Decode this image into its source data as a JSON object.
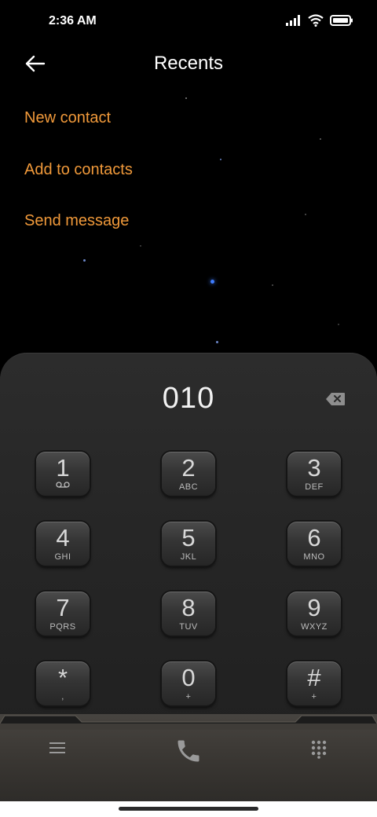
{
  "status_bar": {
    "time": "2:36 AM"
  },
  "header": {
    "title": "Recents"
  },
  "menu": {
    "new_contact": "New contact",
    "add_to_contacts": "Add to contacts",
    "send_message": "Send message"
  },
  "dialer": {
    "number": "010",
    "keys": [
      {
        "digit": "1",
        "letters": ""
      },
      {
        "digit": "2",
        "letters": "ABC"
      },
      {
        "digit": "3",
        "letters": "DEF"
      },
      {
        "digit": "4",
        "letters": "GHI"
      },
      {
        "digit": "5",
        "letters": "JKL"
      },
      {
        "digit": "6",
        "letters": "MNO"
      },
      {
        "digit": "7",
        "letters": "PQRS"
      },
      {
        "digit": "8",
        "letters": "TUV"
      },
      {
        "digit": "9",
        "letters": "WXYZ"
      },
      {
        "digit": "*",
        "letters": ","
      },
      {
        "digit": "0",
        "letters": "+"
      },
      {
        "digit": "#",
        "letters": "+"
      }
    ]
  },
  "colors": {
    "accent": "#f0993a",
    "background": "#000000",
    "panel": "#262626"
  },
  "icons": {
    "back": "arrow-left-icon",
    "signal": "signal-icon",
    "wifi": "wifi-icon",
    "battery": "battery-icon",
    "backspace": "backspace-icon",
    "voicemail": "voicemail-icon",
    "menu": "hamburger-icon",
    "call": "phone-icon",
    "dialpad": "dialpad-icon"
  }
}
